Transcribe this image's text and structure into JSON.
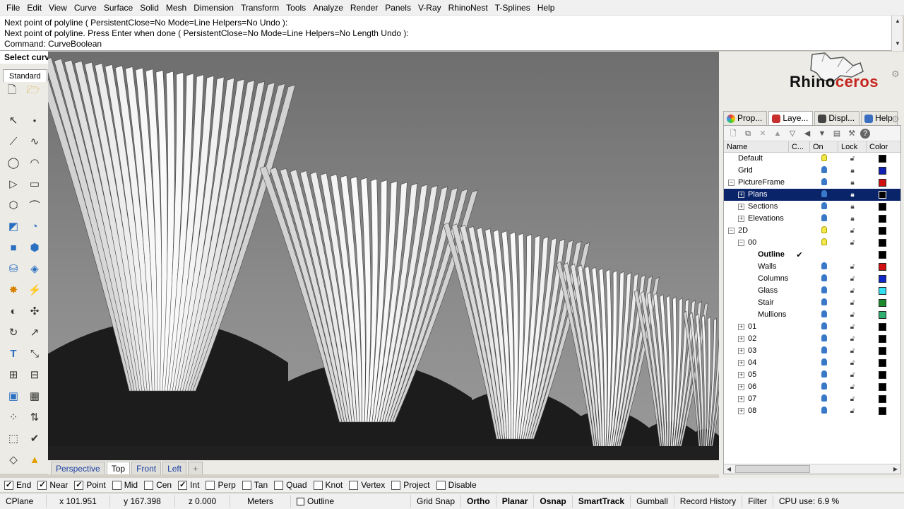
{
  "menu": [
    "File",
    "Edit",
    "View",
    "Curve",
    "Surface",
    "Solid",
    "Mesh",
    "Dimension",
    "Transform",
    "Tools",
    "Analyze",
    "Render",
    "Panels",
    "V-Ray",
    "RhinoNest",
    "T-Splines",
    "Help"
  ],
  "command_history": [
    "Next point of polyline ( PersistentClose=No  Mode=Line  Helpers=No  Undo ):",
    "Next point of polyline. Press Enter when done ( PersistentClose=No  Mode=Line  Helpers=No  Length  Undo ):",
    "Command: CurveBoolean"
  ],
  "command_prompt": "Select curves",
  "toolbar_tab": "Standard",
  "viewport_tabs": [
    "Perspective",
    "Top",
    "Front",
    "Left",
    "+"
  ],
  "active_viewport": "Top",
  "logo": {
    "text_a": "Rhino",
    "text_b": "ceros",
    "color_a": "#111111",
    "color_b": "#c4241d"
  },
  "panel_tabs": [
    {
      "label": "Prop...",
      "icon": "properties-icon"
    },
    {
      "label": "Laye...",
      "icon": "layers-icon"
    },
    {
      "label": "Displ...",
      "icon": "display-icon"
    },
    {
      "label": "Help",
      "icon": "help-icon"
    }
  ],
  "layer_columns": [
    "Name",
    "C...",
    "On",
    "Lock",
    "Color"
  ],
  "layers": [
    {
      "name": "Default",
      "level": 0,
      "expander": "",
      "bulb": "yellow",
      "lock": "unlocked",
      "color": "#000000",
      "current": false,
      "selected": false
    },
    {
      "name": "Grid",
      "level": 0,
      "expander": "",
      "bulb": "blue",
      "lock": "locked",
      "color": "#1020b0",
      "current": false,
      "selected": false
    },
    {
      "name": "PictureFrame",
      "level": 0,
      "expander": "−",
      "bulb": "blue",
      "lock": "locked",
      "color": "#d01010",
      "current": false,
      "selected": false
    },
    {
      "name": "Plans",
      "level": 1,
      "expander": "+",
      "bulb": "blue",
      "lock": "locked",
      "color": "#000000",
      "current": false,
      "selected": true
    },
    {
      "name": "Sections",
      "level": 1,
      "expander": "+",
      "bulb": "blue",
      "lock": "locked",
      "color": "#000000",
      "current": false,
      "selected": false
    },
    {
      "name": "Elevations",
      "level": 1,
      "expander": "+",
      "bulb": "blue",
      "lock": "locked",
      "color": "#000000",
      "current": false,
      "selected": false
    },
    {
      "name": "2D",
      "level": 0,
      "expander": "−",
      "bulb": "yellow",
      "lock": "unlocked",
      "color": "#000000",
      "current": false,
      "selected": false
    },
    {
      "name": "00",
      "level": 1,
      "expander": "−",
      "bulb": "yellow",
      "lock": "unlocked",
      "color": "#000000",
      "current": false,
      "selected": false
    },
    {
      "name": "Outline",
      "level": 2,
      "expander": "",
      "bulb": "",
      "lock": "",
      "color": "#000000",
      "current": true,
      "selected": false
    },
    {
      "name": "Walls",
      "level": 2,
      "expander": "",
      "bulb": "blue",
      "lock": "unlocked",
      "color": "#d01010",
      "current": false,
      "selected": false
    },
    {
      "name": "Columns",
      "level": 2,
      "expander": "",
      "bulb": "blue",
      "lock": "unlocked",
      "color": "#1028c8",
      "current": false,
      "selected": false
    },
    {
      "name": "Glass",
      "level": 2,
      "expander": "",
      "bulb": "blue",
      "lock": "unlocked",
      "color": "#30e0f0",
      "current": false,
      "selected": false
    },
    {
      "name": "Stair",
      "level": 2,
      "expander": "",
      "bulb": "blue",
      "lock": "unlocked",
      "color": "#1a8a2a",
      "current": false,
      "selected": false
    },
    {
      "name": "Mullions",
      "level": 2,
      "expander": "",
      "bulb": "blue",
      "lock": "unlocked",
      "color": "#30b070",
      "current": false,
      "selected": false
    },
    {
      "name": "01",
      "level": 1,
      "expander": "+",
      "bulb": "blue",
      "lock": "unlocked",
      "color": "#000000",
      "current": false,
      "selected": false
    },
    {
      "name": "02",
      "level": 1,
      "expander": "+",
      "bulb": "blue",
      "lock": "unlocked",
      "color": "#000000",
      "current": false,
      "selected": false
    },
    {
      "name": "03",
      "level": 1,
      "expander": "+",
      "bulb": "blue",
      "lock": "unlocked",
      "color": "#000000",
      "current": false,
      "selected": false
    },
    {
      "name": "04",
      "level": 1,
      "expander": "+",
      "bulb": "blue",
      "lock": "unlocked",
      "color": "#000000",
      "current": false,
      "selected": false
    },
    {
      "name": "05",
      "level": 1,
      "expander": "+",
      "bulb": "blue",
      "lock": "unlocked",
      "color": "#000000",
      "current": false,
      "selected": false
    },
    {
      "name": "06",
      "level": 1,
      "expander": "+",
      "bulb": "blue",
      "lock": "unlocked",
      "color": "#000000",
      "current": false,
      "selected": false
    },
    {
      "name": "07",
      "level": 1,
      "expander": "+",
      "bulb": "blue",
      "lock": "unlocked",
      "color": "#000000",
      "current": false,
      "selected": false
    },
    {
      "name": "08",
      "level": 1,
      "expander": "+",
      "bulb": "blue",
      "lock": "unlocked",
      "color": "#000000",
      "current": false,
      "selected": false
    }
  ],
  "osnaps": [
    {
      "label": "End",
      "checked": true
    },
    {
      "label": "Near",
      "checked": true
    },
    {
      "label": "Point",
      "checked": true
    },
    {
      "label": "Mid",
      "checked": false
    },
    {
      "label": "Cen",
      "checked": false
    },
    {
      "label": "Int",
      "checked": true
    },
    {
      "label": "Perp",
      "checked": false
    },
    {
      "label": "Tan",
      "checked": false
    },
    {
      "label": "Quad",
      "checked": false
    },
    {
      "label": "Knot",
      "checked": false
    },
    {
      "label": "Vertex",
      "checked": false
    },
    {
      "label": "Project",
      "checked": false
    },
    {
      "label": "Disable",
      "checked": false
    }
  ],
  "status": {
    "cplane": "CPlane",
    "x": "x 101.951",
    "y": "y 167.398",
    "z": "z 0.000",
    "units": "Meters",
    "layer": "Outline",
    "grid_snap": "Grid Snap",
    "ortho": "Ortho",
    "planar": "Planar",
    "osnap": "Osnap",
    "smarttrack": "SmartTrack",
    "gumball": "Gumball",
    "record_history": "Record History",
    "filter": "Filter",
    "cpu": "CPU use: 6.9 %"
  }
}
